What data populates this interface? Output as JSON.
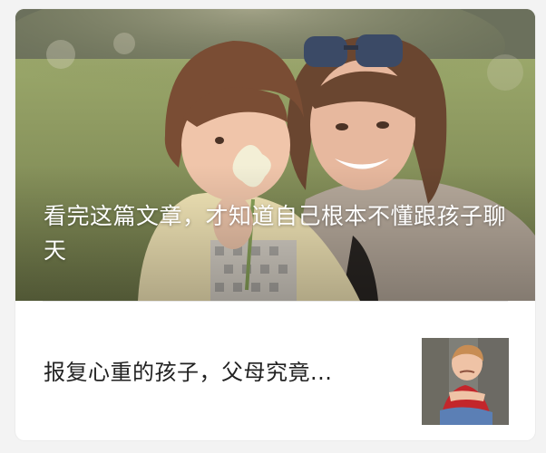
{
  "feed_card": {
    "main_article": {
      "title": "看完这篇文章，才知道自己根本不懂跟孩子聊天",
      "image": "mother-and-child-photo"
    },
    "sub_article": {
      "title": "报复心重的孩子，父母究竟...",
      "thumbnail": "angry-child-photo"
    }
  },
  "colors": {
    "background": "#f3f3f3",
    "card": "#ffffff",
    "title_on_image": "#ffffff",
    "item_title": "#222222",
    "divider": "#e6e6e6"
  }
}
